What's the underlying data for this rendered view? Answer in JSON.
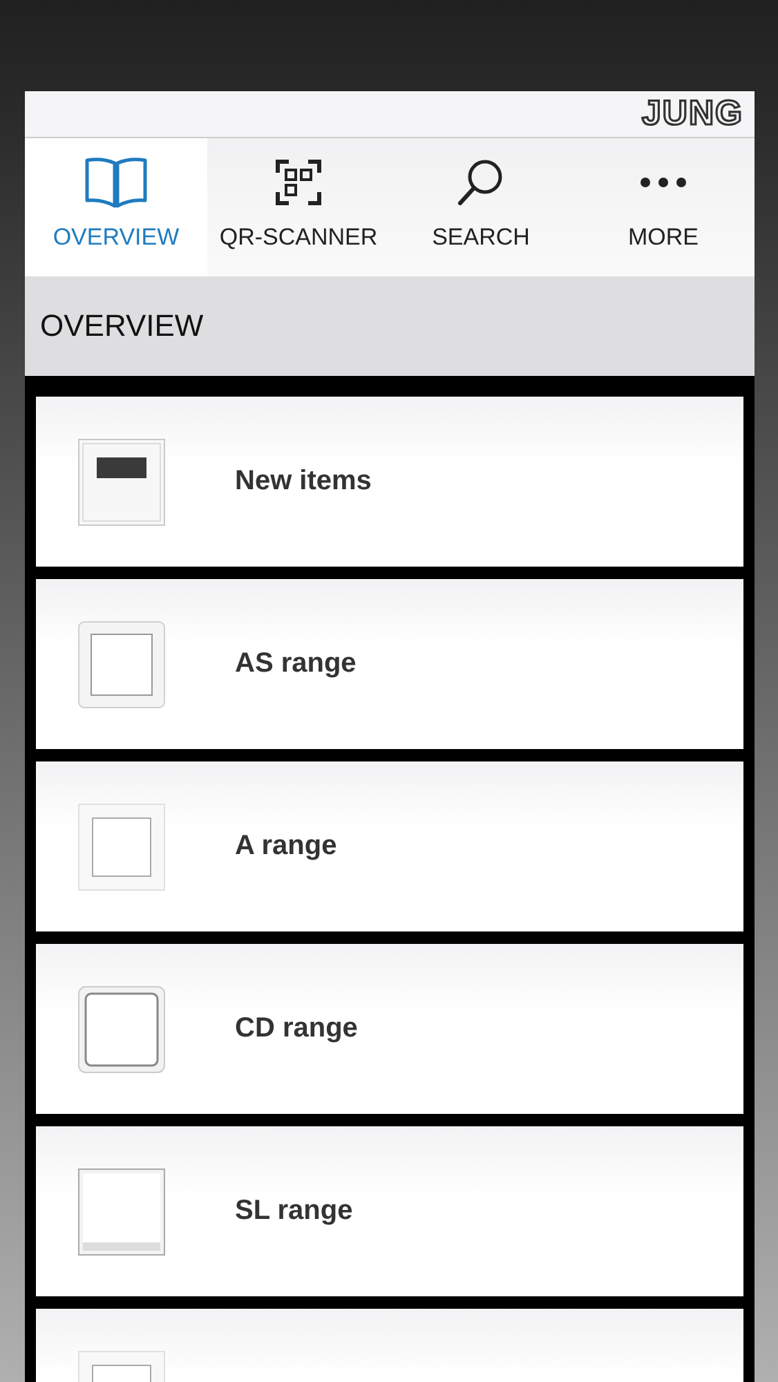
{
  "brand": "JUNG",
  "tabs": [
    {
      "label": "OVERVIEW",
      "selected": true
    },
    {
      "label": "QR-SCANNER",
      "selected": false
    },
    {
      "label": "SEARCH",
      "selected": false
    },
    {
      "label": "MORE",
      "selected": false
    }
  ],
  "header": "OVERVIEW",
  "items": [
    {
      "kind": "item",
      "label": "New items"
    },
    {
      "kind": "item",
      "label": "AS range"
    },
    {
      "kind": "item",
      "label": "A range"
    },
    {
      "kind": "item",
      "label": "CD range"
    },
    {
      "kind": "item",
      "label": "SL range"
    },
    {
      "kind": "cut-off"
    }
  ]
}
